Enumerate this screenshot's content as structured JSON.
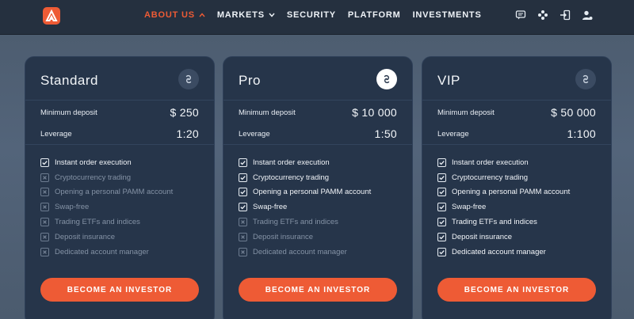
{
  "nav": {
    "items": [
      {
        "label": "ABOUT US",
        "active": true,
        "dropdown": true
      },
      {
        "label": "MARKETS",
        "active": false,
        "dropdown": true
      },
      {
        "label": "SECURITY",
        "active": false,
        "dropdown": false
      },
      {
        "label": "PLATFORM",
        "active": false,
        "dropdown": false
      },
      {
        "label": "INVESTMENTS",
        "active": false,
        "dropdown": false
      }
    ],
    "icons": [
      "chat-icon",
      "support-icon",
      "login-icon",
      "user-icon"
    ]
  },
  "colors": {
    "accent": "#ee5b35",
    "card_bg": "#26354a",
    "topbar_bg": "#25303f"
  },
  "plans": [
    {
      "name": "Standard",
      "badge_icon": "link-icon",
      "min_deposit_label": "Minimum deposit",
      "min_deposit": "$ 250",
      "leverage_label": "Leverage",
      "leverage": "1:20",
      "features": [
        {
          "label": "Instant order execution",
          "included": true
        },
        {
          "label": "Cryptocurrency trading",
          "included": false
        },
        {
          "label": "Opening a personal PAMM account",
          "included": false
        },
        {
          "label": "Swap-free",
          "included": false
        },
        {
          "label": "Trading ETFs and indices",
          "included": false
        },
        {
          "label": "Deposit insurance",
          "included": false
        },
        {
          "label": "Dedicated account manager",
          "included": false
        }
      ],
      "button": "BECOME AN INVESTOR"
    },
    {
      "name": "Pro",
      "badge_icon": "link-icon",
      "min_deposit_label": "Minimum deposit",
      "min_deposit": "$ 10 000",
      "leverage_label": "Leverage",
      "leverage": "1:50",
      "features": [
        {
          "label": "Instant order execution",
          "included": true
        },
        {
          "label": "Cryptocurrency trading",
          "included": true
        },
        {
          "label": "Opening a personal PAMM account",
          "included": true
        },
        {
          "label": "Swap-free",
          "included": true
        },
        {
          "label": "Trading ETFs and indices",
          "included": false
        },
        {
          "label": "Deposit insurance",
          "included": false
        },
        {
          "label": "Dedicated account manager",
          "included": false
        }
      ],
      "button": "BECOME AN INVESTOR"
    },
    {
      "name": "VIP",
      "badge_icon": "link-icon",
      "min_deposit_label": "Minimum deposit",
      "min_deposit": "$ 50 000",
      "leverage_label": "Leverage",
      "leverage": "1:100",
      "features": [
        {
          "label": "Instant order execution",
          "included": true
        },
        {
          "label": "Cryptocurrency trading",
          "included": true
        },
        {
          "label": "Opening a personal PAMM account",
          "included": true
        },
        {
          "label": "Swap-free",
          "included": true
        },
        {
          "label": "Trading ETFs and indices",
          "included": true
        },
        {
          "label": "Deposit insurance",
          "included": true
        },
        {
          "label": "Dedicated account manager",
          "included": true
        }
      ],
      "button": "BECOME AN INVESTOR"
    }
  ]
}
